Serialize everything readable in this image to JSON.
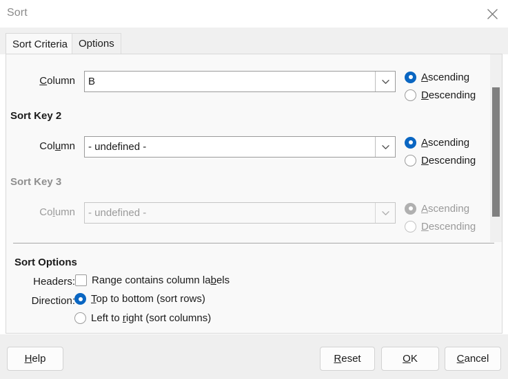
{
  "window": {
    "title": "Sort",
    "close_icon": "close-icon"
  },
  "tabs": [
    {
      "label": "Sort Criteria",
      "active": true
    },
    {
      "label": "Options",
      "active": false
    }
  ],
  "sort_criteria": {
    "keys": [
      {
        "heading": "",
        "column_label": "Column",
        "column_value": "B",
        "dropdown_icon": "chevron-down-icon",
        "order": {
          "ascending_label": "Ascending",
          "descending_label": "Descending",
          "selected": "Ascending"
        },
        "disabled": false
      },
      {
        "heading": "Sort Key 2",
        "column_label": "Column",
        "column_value": "- undefined -",
        "dropdown_icon": "chevron-down-icon",
        "order": {
          "ascending_label": "Ascending",
          "descending_label": "Descending",
          "selected": "Ascending"
        },
        "disabled": false
      },
      {
        "heading": "Sort Key 3",
        "column_label": "Column",
        "column_value": "- undefined -",
        "dropdown_icon": "chevron-down-icon",
        "order": {
          "ascending_label": "Ascending",
          "descending_label": "Descending",
          "selected": "Ascending"
        },
        "disabled": true
      }
    ],
    "scrollbar": {
      "orientation": "vertical"
    }
  },
  "sort_options": {
    "title": "Sort Options",
    "headers_label": "Headers:",
    "headers_checkbox_label": "Range contains column labels",
    "headers_checked": false,
    "direction_label": "Direction:",
    "direction_options": [
      "Top to bottom (sort rows)",
      "Left to right (sort columns)"
    ],
    "direction_selected": "Top to bottom (sort rows)"
  },
  "buttons": {
    "help": "Help",
    "reset": "Reset",
    "ok": "OK",
    "cancel": "Cancel"
  },
  "colors": {
    "accent": "#0a66c2",
    "panel_bg": "#f9f9f9",
    "buttonbar_bg": "#efefef",
    "disabled_text": "#9a9a9a",
    "scroll_thumb": "#808080"
  }
}
